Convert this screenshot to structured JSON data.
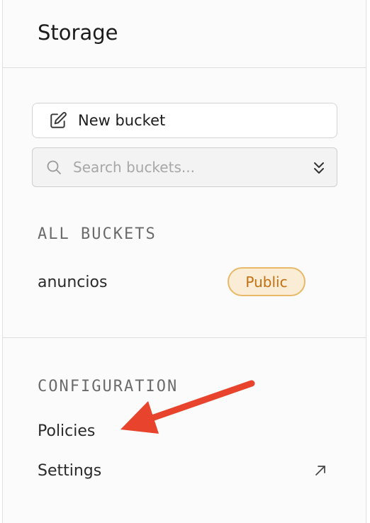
{
  "app": {
    "title": "Storage"
  },
  "actions": {
    "new_bucket_label": "New bucket"
  },
  "search": {
    "placeholder": "Search buckets...",
    "value": ""
  },
  "buckets": {
    "section_label": "ALL BUCKETS",
    "items": [
      {
        "name": "anuncios",
        "badge": "Public"
      }
    ]
  },
  "configuration": {
    "section_label": "CONFIGURATION",
    "items": [
      {
        "label": "Policies"
      },
      {
        "label": "Settings",
        "icon": "external-link-icon"
      }
    ]
  },
  "annotation": {
    "type": "arrow",
    "color": "#e8432d",
    "points_to": "Policies"
  },
  "colors": {
    "badge_bg": "#fbecd6",
    "badge_border": "#e9b96a",
    "badge_text": "#c46f10",
    "annotation_arrow": "#e8432d"
  }
}
